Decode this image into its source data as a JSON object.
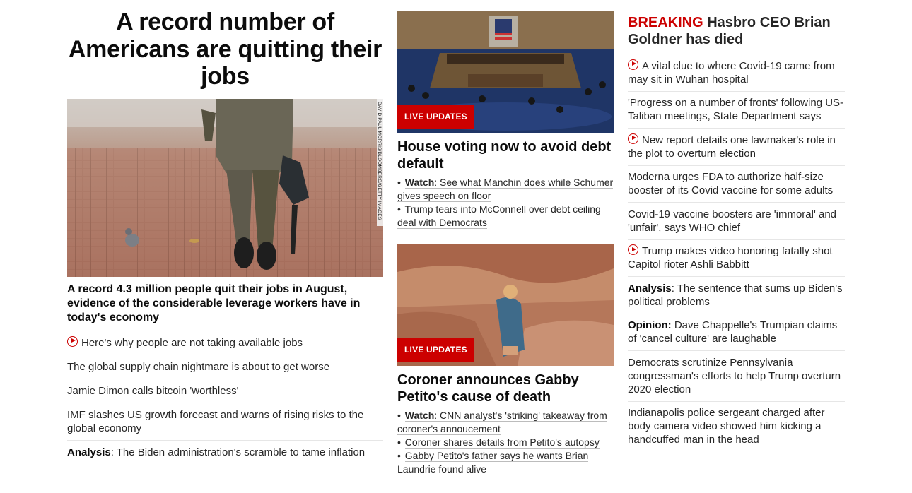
{
  "left": {
    "hero_title": "A record number of Americans are quitting their jobs",
    "photo_credit": "DAVID PAUL MORRIS/BLOOMBERG/GETTY IMAGES",
    "lead_headline": "A record 4.3 million people quit their jobs in August, evidence of the considerable leverage workers have in today's economy",
    "items": [
      {
        "prefix": "",
        "text": "Here's why people are not taking available jobs",
        "video": true
      },
      {
        "prefix": "",
        "text": "The global supply chain nightmare is about to get worse",
        "video": false
      },
      {
        "prefix": "",
        "text": "Jamie Dimon calls bitcoin 'worthless'",
        "video": false
      },
      {
        "prefix": "",
        "text": "IMF slashes US growth forecast and warns of rising risks to the global economy",
        "video": false
      },
      {
        "prefix": "Analysis",
        "text": ": The Biden administration's scramble to tame inflation",
        "video": false
      }
    ]
  },
  "middle": {
    "story1": {
      "badge": "LIVE UPDATES",
      "headline": "House voting now to avoid debt default",
      "bullets": [
        {
          "lead": "Watch",
          "text": ": See what Manchin does while Schumer gives speech on floor"
        },
        {
          "lead": "",
          "text": "Trump tears into McConnell over debt ceiling deal with Democrats"
        }
      ]
    },
    "story2": {
      "badge": "LIVE UPDATES",
      "headline": "Coroner announces Gabby Petito's cause of death",
      "bullets": [
        {
          "lead": "Watch",
          "text": ": CNN analyst's 'striking' takeaway from coroner's annoucement"
        },
        {
          "lead": "",
          "text": "Coroner shares details from Petito's autopsy"
        },
        {
          "lead": "",
          "text": "Gabby Petito's father says he wants Brian Laundrie found alive"
        }
      ]
    }
  },
  "right": {
    "breaking_tag": "BREAKING",
    "breaking_text": "Hasbro CEO Brian Goldner has died",
    "items": [
      {
        "prefix": "",
        "text": "A vital clue to where Covid-19 came from may sit in Wuhan hospital",
        "video": true
      },
      {
        "prefix": "",
        "text": "'Progress on a number of fronts' following US-Taliban meetings, State Department says",
        "video": false
      },
      {
        "prefix": "",
        "text": "New report details one lawmaker's role in the plot to overturn election",
        "video": true
      },
      {
        "prefix": "",
        "text": "Moderna urges FDA to authorize half-size booster of its Covid vaccine for some adults",
        "video": false
      },
      {
        "prefix": "",
        "text": "Covid-19 vaccine boosters are 'immoral' and 'unfair', says WHO chief",
        "video": false
      },
      {
        "prefix": "",
        "text": "Trump makes video honoring fatally shot Capitol rioter Ashli Babbitt",
        "video": true
      },
      {
        "prefix": "Analysis",
        "text": ": The sentence that sums up Biden's political problems",
        "video": false
      },
      {
        "prefix": "Opinion:",
        "text": " Dave Chappelle's Trumpian claims of 'cancel culture' are laughable",
        "video": false
      },
      {
        "prefix": "",
        "text": "Democrats scrutinize Pennsylvania congressman's efforts to help Trump overturn 2020 election",
        "video": false
      },
      {
        "prefix": "",
        "text": "Indianapolis police sergeant charged after body camera video showed him kicking a handcuffed man in the head",
        "video": false
      }
    ]
  },
  "colors": {
    "accent": "#cc0000",
    "text": "#0c0c0c",
    "divider": "#e6e6e6"
  }
}
